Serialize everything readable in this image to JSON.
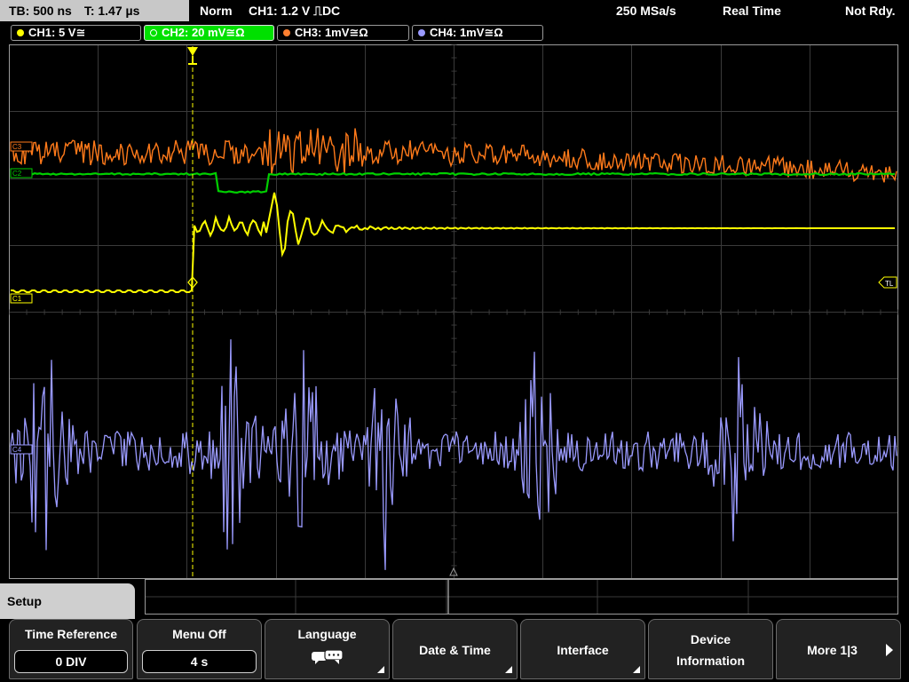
{
  "status": {
    "timebase": "TB: 500 ns",
    "trigger_time": "T: 1.47 µs",
    "trigger_mode": "Norm",
    "trigger_source": "CH1: 1.2 V ⎍DC",
    "sample_rate": "250 MSa/s",
    "acquisition": "Real Time",
    "state": "Not Rdy."
  },
  "channels": [
    {
      "label": "CH1: 5 V≅",
      "color": "#ffff00",
      "active": false
    },
    {
      "label": "CH2: 20 mV≅Ω",
      "color": "#00e000",
      "active": true
    },
    {
      "label": "CH3: 1mV≅Ω",
      "color": "#ff8030",
      "active": false
    },
    {
      "label": "CH4: 1mV≅Ω",
      "color": "#9999ff",
      "active": false
    }
  ],
  "markers": {
    "trigger_level": "TL",
    "ch1_marker": "C1",
    "ch2_marker": "C2",
    "ch3_marker": "C3",
    "ch4_marker": "C4"
  },
  "menu": {
    "title": "Setup",
    "softkeys": [
      {
        "label": "Time Reference",
        "value": "0 DIV"
      },
      {
        "label": "Menu Off",
        "value": "4 s"
      },
      {
        "label": "Language",
        "icon": "speech-bubbles-icon"
      },
      {
        "label": "Date & Time"
      },
      {
        "label": "Interface"
      },
      {
        "label_line1": "Device",
        "label_line2": "Information"
      },
      {
        "label": "More 1|3"
      }
    ]
  },
  "colors": {
    "ch1": "#ffff00",
    "ch2": "#00d000",
    "ch3": "#ff7a1a",
    "ch4": "#9a9aff",
    "grid": "#3a3a3a",
    "active_tab": "#00e000"
  }
}
